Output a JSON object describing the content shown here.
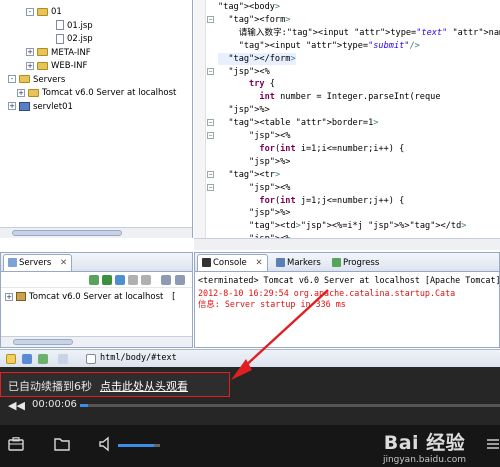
{
  "project_tree": {
    "items": [
      {
        "label": "01",
        "indent": 2,
        "icon": "folder",
        "expander": "-"
      },
      {
        "label": "01.jsp",
        "indent": 4,
        "icon": "file",
        "expander": ""
      },
      {
        "label": "02.jsp",
        "indent": 4,
        "icon": "file",
        "expander": ""
      },
      {
        "label": "META-INF",
        "indent": 2,
        "icon": "folder",
        "expander": "+"
      },
      {
        "label": "WEB-INF",
        "indent": 2,
        "icon": "folder",
        "expander": "+"
      },
      {
        "label": "Servers",
        "indent": 0,
        "icon": "folder",
        "expander": "-"
      },
      {
        "label": "Tomcat v6.0 Server at localhost",
        "indent": 1,
        "icon": "folder",
        "expander": "+"
      },
      {
        "label": "servlet01",
        "indent": 0,
        "icon": "project",
        "expander": "+"
      }
    ]
  },
  "editor": {
    "lines": [
      "<body>",
      "  <form>",
      "    请输入数字:<input type=\"text\" name=\"numb",
      "    <input type=\"submit\"/>",
      "  </form>",
      "  <%",
      "      try {",
      "        int number = Integer.parseInt(reque",
      "  %>",
      "  <table border=1>",
      "      <%",
      "        for(int i=1;i<=number;i++) {",
      "      %>",
      "  <tr>",
      "      <%",
      "        for(int j=1;j<=number;j++) {",
      "      %>",
      "      <td><%=i*j %></td>",
      "      <%"
    ]
  },
  "servers_view": {
    "tab_label": "Servers",
    "close_glyph": "✕",
    "items": [
      {
        "label": "Tomcat v6.0 Server at localhost",
        "status": "["
      }
    ]
  },
  "console_view": {
    "tabs": [
      {
        "label": "Console"
      },
      {
        "label": "Markers"
      },
      {
        "label": "Progress"
      }
    ],
    "terminated_line": "<terminated> Tomcat v6.0 Server at localhost [Apache Tomcat] D:\\Java\\",
    "log_lines": [
      "2012-8-10 16:29:54 org.apache.catalina.startup.Cata",
      "信息: Server startup in 336 ms"
    ]
  },
  "status_bar": {
    "path": "html/body/#text"
  },
  "player": {
    "toast_text": "已自动续播到6秒",
    "toast_link": "点击此处从头观看",
    "timecode": "00:00:06",
    "progress_fraction": 0.02,
    "volume_fraction": 0.85,
    "rewind_glyph": "◀◀",
    "accent": "#3a8ee6"
  },
  "watermark": {
    "logo_text": "Bai 经验",
    "url": "jingyan.baidu.com"
  }
}
